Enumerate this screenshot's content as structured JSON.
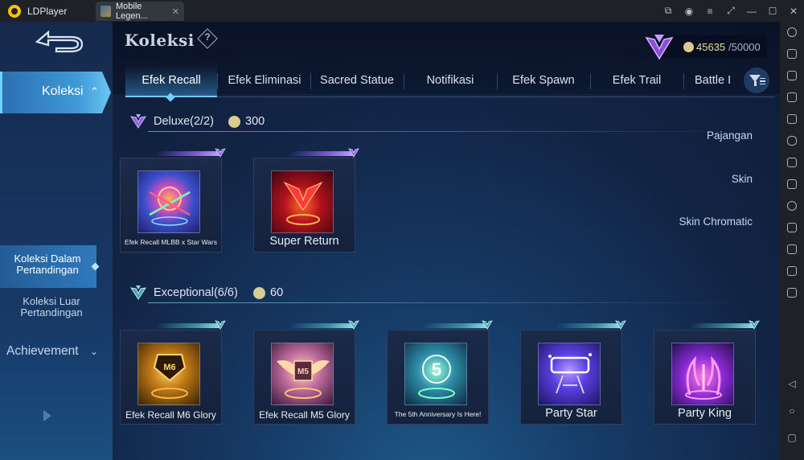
{
  "window": {
    "app_name": "LDPlayer",
    "tab_title": "Mobile Legen...",
    "tab_close": "✕",
    "controls": [
      "⧉",
      "◉",
      "≡",
      "⤢",
      "—",
      "☐",
      "✕"
    ]
  },
  "header": {
    "title": "Koleksi",
    "help_symbol": "?",
    "points_current": "45635",
    "points_max": "/50000"
  },
  "sidebar": {
    "active_label": "Koleksi",
    "active_chevron": "^",
    "items": [
      {
        "label": "Pajangan"
      },
      {
        "label": "Skin"
      },
      {
        "label": "Skin Chromatic"
      },
      {
        "label": "Koleksi Dalam Pertandingan"
      },
      {
        "label": "Koleksi Luar Pertandingan"
      }
    ],
    "achievement_label": "Achievement",
    "achievement_chevron": "⌄"
  },
  "tabs": [
    {
      "label": "Efek Recall",
      "active": true
    },
    {
      "label": "Efek Eliminasi"
    },
    {
      "label": "Sacred Statue"
    },
    {
      "label": "Notifikasi"
    },
    {
      "label": "Efek Spawn"
    },
    {
      "label": "Efek Trail"
    },
    {
      "label": "Battle I"
    }
  ],
  "sections": [
    {
      "title": "Deluxe(2/2)",
      "cost": "300",
      "theme_color": "#8a63e0",
      "items": [
        {
          "label": "Efek Recall MLBB x Star Wars",
          "icon": "starwars-ring-art"
        },
        {
          "label": "Super Return",
          "icon": "red-v-slash-art"
        }
      ]
    },
    {
      "title": "Exceptional(6/6)",
      "cost": "60",
      "theme_color": "#46a3b3",
      "items": [
        {
          "label": "Efek Recall M6 Glory",
          "icon": "m6-trophy-art"
        },
        {
          "label": "Efek Recall M5 Glory",
          "icon": "m5-wings-art"
        },
        {
          "label": "The 5th Anniversary Is Here!",
          "icon": "anniversary-5-art"
        },
        {
          "label": "Party Star",
          "icon": "party-star-art"
        },
        {
          "label": "Party King",
          "icon": "party-king-art"
        }
      ]
    }
  ],
  "colors": {
    "accent": "#6fd2ff",
    "coin": "#d8cb94",
    "background": "#122445"
  }
}
